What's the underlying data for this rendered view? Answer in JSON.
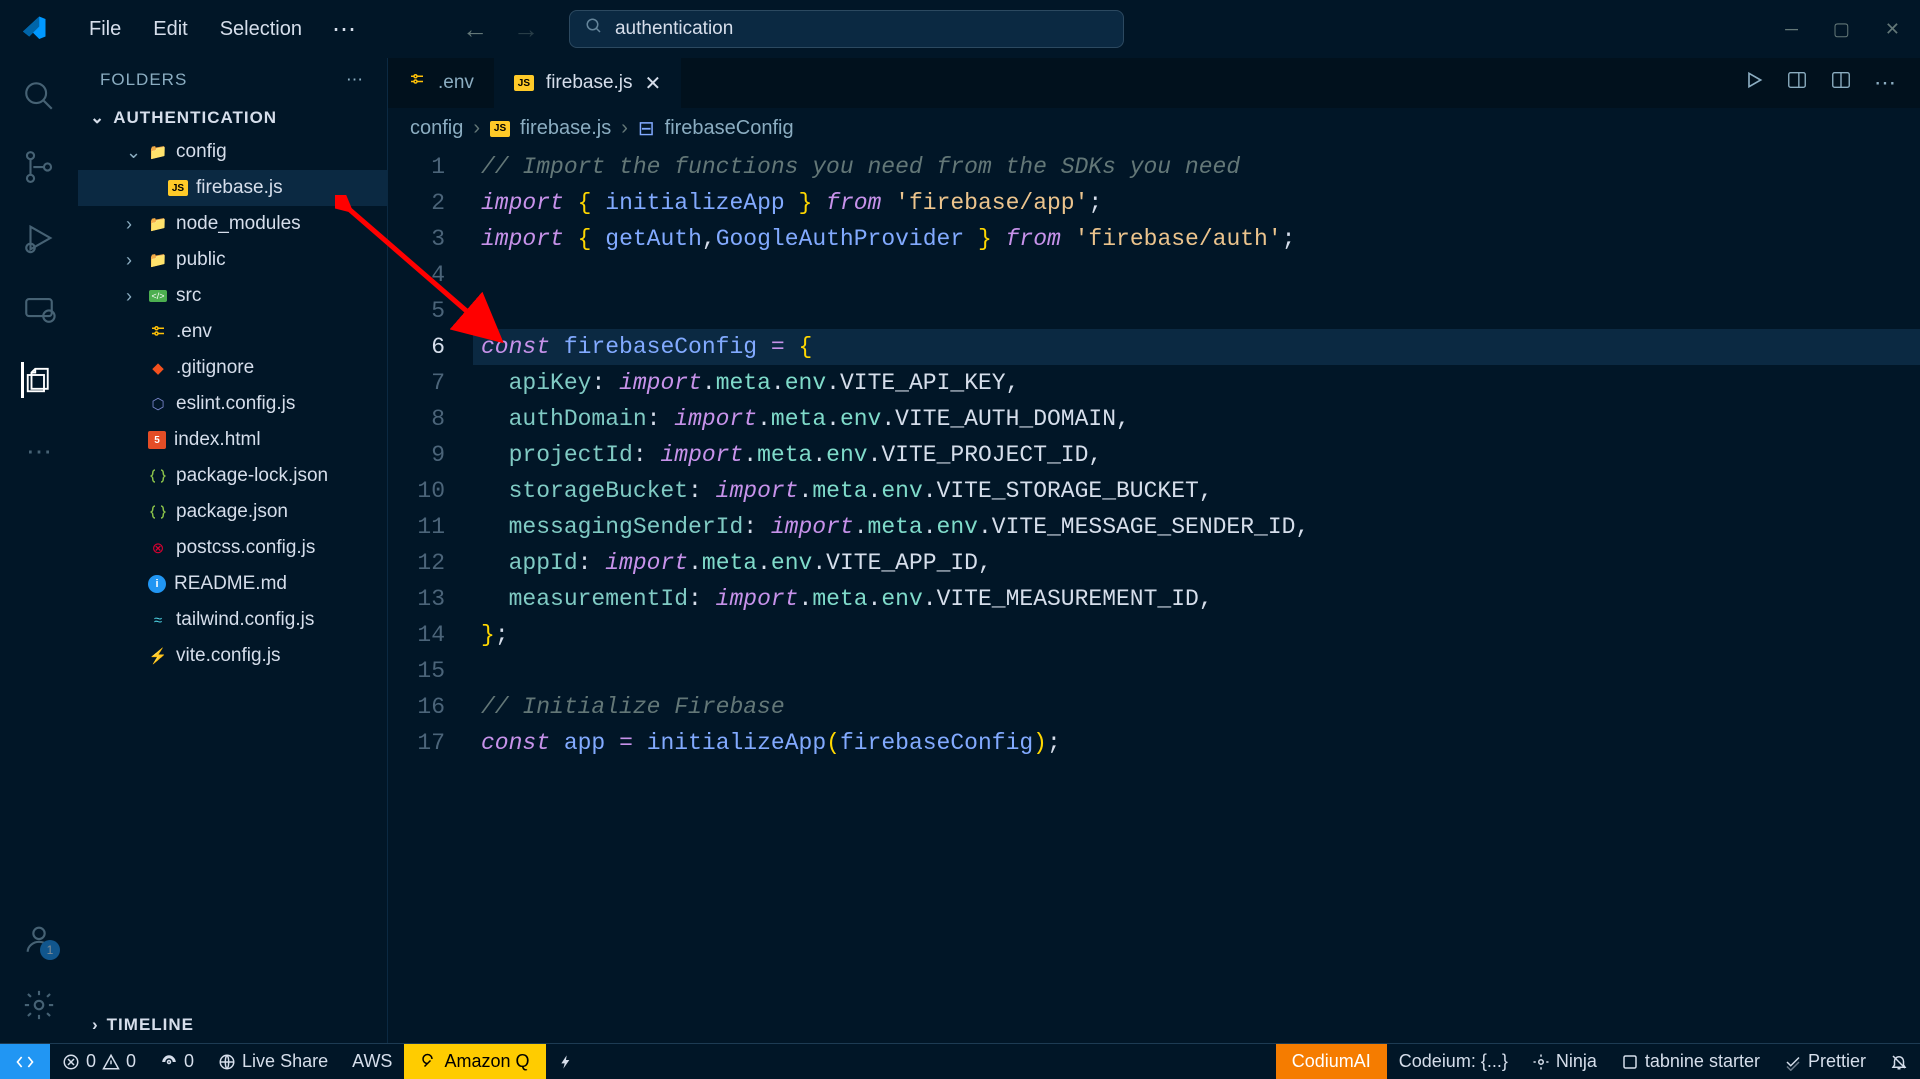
{
  "titlebar": {
    "menus": [
      "File",
      "Edit",
      "Selection"
    ],
    "search_text": "authentication"
  },
  "sidebar": {
    "header": "FOLDERS",
    "workspace": "AUTHENTICATION",
    "tree": [
      {
        "type": "folder",
        "name": "config",
        "expanded": true,
        "indent": 0,
        "icon": "folder-cfg"
      },
      {
        "type": "file",
        "name": "firebase.js",
        "indent": 1,
        "icon": "js",
        "selected": true
      },
      {
        "type": "folder",
        "name": "node_modules",
        "expanded": false,
        "indent": 0,
        "icon": "folder-node"
      },
      {
        "type": "folder",
        "name": "public",
        "expanded": false,
        "indent": 0,
        "icon": "folder-pub"
      },
      {
        "type": "folder",
        "name": "src",
        "expanded": false,
        "indent": 0,
        "icon": "folder-src"
      },
      {
        "type": "file",
        "name": ".env",
        "indent": 0,
        "icon": "env"
      },
      {
        "type": "file",
        "name": ".gitignore",
        "indent": 0,
        "icon": "git"
      },
      {
        "type": "file",
        "name": "eslint.config.js",
        "indent": 0,
        "icon": "eslint"
      },
      {
        "type": "file",
        "name": "index.html",
        "indent": 0,
        "icon": "html"
      },
      {
        "type": "file",
        "name": "package-lock.json",
        "indent": 0,
        "icon": "json"
      },
      {
        "type": "file",
        "name": "package.json",
        "indent": 0,
        "icon": "json"
      },
      {
        "type": "file",
        "name": "postcss.config.js",
        "indent": 0,
        "icon": "postcss"
      },
      {
        "type": "file",
        "name": "README.md",
        "indent": 0,
        "icon": "readme"
      },
      {
        "type": "file",
        "name": "tailwind.config.js",
        "indent": 0,
        "icon": "tailwind"
      },
      {
        "type": "file",
        "name": "vite.config.js",
        "indent": 0,
        "icon": "vite"
      }
    ],
    "timeline": "TIMELINE"
  },
  "tabs": [
    {
      "name": ".env",
      "icon": "env",
      "active": false
    },
    {
      "name": "firebase.js",
      "icon": "js",
      "active": true
    }
  ],
  "breadcrumb": {
    "parts": [
      "config",
      "firebase.js",
      "firebaseConfig"
    ]
  },
  "code": {
    "lines": [
      {
        "n": 1,
        "html": "<span class='c-comment'>// Import the functions you need from the SDKs you need</span>"
      },
      {
        "n": 2,
        "html": "<span class='c-import'>import</span> <span class='c-brace'>{</span> <span class='c-var'>initializeApp</span> <span class='c-brace'>}</span> <span class='c-from'>from</span> <span class='c-string'>'firebase/app'</span><span class='c-punct'>;</span>"
      },
      {
        "n": 3,
        "html": "<span class='c-import'>import</span> <span class='c-brace'>{</span> <span class='c-var'>getAuth</span><span class='c-punct'>,</span><span class='c-var'>GoogleAuthProvider</span> <span class='c-brace'>}</span> <span class='c-from'>from</span> <span class='c-string'>'firebase/auth'</span><span class='c-punct'>;</span>"
      },
      {
        "n": 4,
        "html": ""
      },
      {
        "n": 5,
        "html": ""
      },
      {
        "n": 6,
        "html": "<span class='c-const'>const</span> <span class='c-var'>firebaseConfig</span> <span class='c-op'>=</span> <span class='c-brace'>{</span>",
        "hl": true
      },
      {
        "n": 7,
        "html": "  <span class='c-prop'>apiKey</span><span class='c-punct'>:</span> <span class='c-keyword'>import</span><span class='c-punct'>.</span><span class='c-member'>meta</span><span class='c-punct'>.</span><span class='c-member'>env</span><span class='c-punct'>.</span><span class='c-ident'>VITE_API_KEY</span><span class='c-punct'>,</span>"
      },
      {
        "n": 8,
        "html": "  <span class='c-prop'>authDomain</span><span class='c-punct'>:</span> <span class='c-keyword'>import</span><span class='c-punct'>.</span><span class='c-member'>meta</span><span class='c-punct'>.</span><span class='c-member'>env</span><span class='c-punct'>.</span><span class='c-ident'>VITE_AUTH_DOMAIN</span><span class='c-punct'>,</span>"
      },
      {
        "n": 9,
        "html": "  <span class='c-prop'>projectId</span><span class='c-punct'>:</span> <span class='c-keyword'>import</span><span class='c-punct'>.</span><span class='c-member'>meta</span><span class='c-punct'>.</span><span class='c-member'>env</span><span class='c-punct'>.</span><span class='c-ident'>VITE_PROJECT_ID</span><span class='c-punct'>,</span>"
      },
      {
        "n": 10,
        "html": "  <span class='c-prop'>storageBucket</span><span class='c-punct'>:</span> <span class='c-keyword'>import</span><span class='c-punct'>.</span><span class='c-member'>meta</span><span class='c-punct'>.</span><span class='c-member'>env</span><span class='c-punct'>.</span><span class='c-ident'>VITE_STORAGE_BUCKET</span><span class='c-punct'>,</span>"
      },
      {
        "n": 11,
        "html": "  <span class='c-prop'>messagingSenderId</span><span class='c-punct'>:</span> <span class='c-keyword'>import</span><span class='c-punct'>.</span><span class='c-member'>meta</span><span class='c-punct'>.</span><span class='c-member'>env</span><span class='c-punct'>.</span><span class='c-ident'>VITE_MESSAGE_SENDER_ID</span><span class='c-punct'>,</span>"
      },
      {
        "n": 12,
        "html": "  <span class='c-prop'>appId</span><span class='c-punct'>:</span> <span class='c-keyword'>import</span><span class='c-punct'>.</span><span class='c-member'>meta</span><span class='c-punct'>.</span><span class='c-member'>env</span><span class='c-punct'>.</span><span class='c-ident'>VITE_APP_ID</span><span class='c-punct'>,</span>"
      },
      {
        "n": 13,
        "html": "  <span class='c-prop'>measurementId</span><span class='c-punct'>:</span> <span class='c-keyword'>import</span><span class='c-punct'>.</span><span class='c-member'>meta</span><span class='c-punct'>.</span><span class='c-member'>env</span><span class='c-punct'>.</span><span class='c-ident'>VITE_MEASUREMENT_ID</span><span class='c-punct'>,</span>"
      },
      {
        "n": 14,
        "html": "<span class='c-brace'>}</span><span class='c-punct'>;</span>"
      },
      {
        "n": 15,
        "html": ""
      },
      {
        "n": 16,
        "html": "<span class='c-comment'>// Initialize Firebase</span>"
      },
      {
        "n": 17,
        "html": "<span class='c-const'>const</span> <span class='c-var'>app</span> <span class='c-op'>=</span> <span class='c-func'>initializeApp</span><span class='c-brace'>(</span><span class='c-var'>firebaseConfig</span><span class='c-brace'>)</span><span class='c-punct'>;</span>"
      }
    ],
    "current_line": 6
  },
  "statusbar": {
    "errors": "0",
    "warnings": "0",
    "ports": "0",
    "live_share": "Live Share",
    "aws": "AWS",
    "amazon_q": "Amazon Q",
    "codium": "CodiumAI",
    "codeium": "Codeium: {...}",
    "ninja": "Ninja",
    "tabnine": "tabnine starter",
    "prettier": "Prettier"
  },
  "activity_badge": "1"
}
